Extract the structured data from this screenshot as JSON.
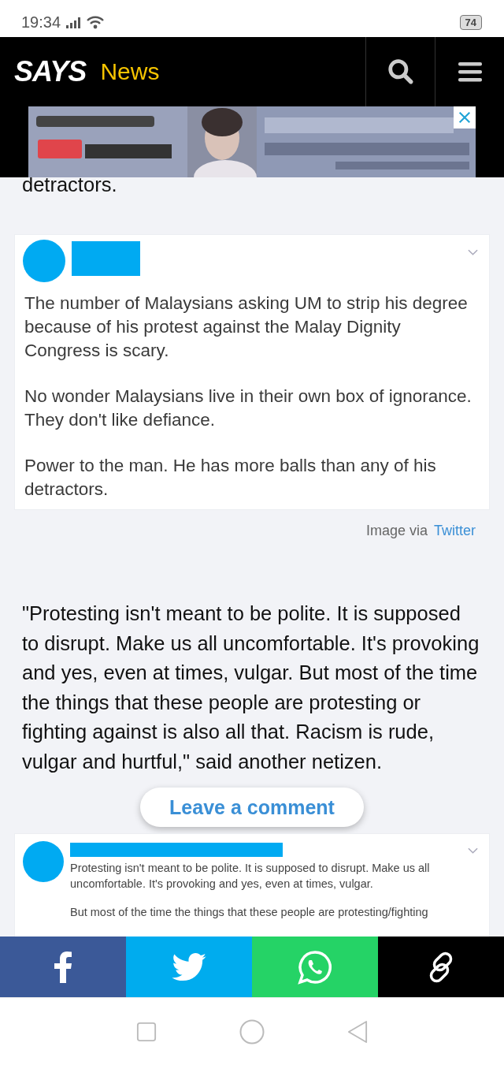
{
  "status_bar": {
    "time": "19:34",
    "battery": "74"
  },
  "header": {
    "logo": "SAYS",
    "section": "News"
  },
  "article": {
    "cut_line": "detractors.",
    "tweet_1": {
      "paragraphs": [
        "The number of Malaysians asking UM to strip his degree because of his protest against the Malay Dignity Congress is scary.",
        "No wonder Malaysians live in their own box of ignorance. They don't like defiance.",
        "Power to the man. He has more balls than any of his detractors."
      ]
    },
    "credit": {
      "label": "Image via",
      "link": "Twitter"
    },
    "quote": "\"Protesting isn't meant to be polite. It is supposed to disrupt. Make us all uncomfortable. It's provoking and yes, even at times, vulgar. But most of the time the things that these people are protesting or fighting against is also all that. Racism is rude, vulgar and hurtful,\" said another netizen.",
    "tweet_2": {
      "paragraphs": [
        "Protesting isn't meant to be polite. It is supposed to disrupt. Make us all uncomfortable. It's provoking and yes, even at times, vulgar.",
        "But most of the time the things that these people are protesting/fighting"
      ]
    }
  },
  "comment_button": "Leave a comment",
  "share_bar": [
    {
      "kind": "facebook",
      "color": "#3b5998"
    },
    {
      "kind": "twitter",
      "color": "#00acee"
    },
    {
      "kind": "whatsapp",
      "color": "#25d366"
    },
    {
      "kind": "link",
      "color": "#000000"
    }
  ]
}
